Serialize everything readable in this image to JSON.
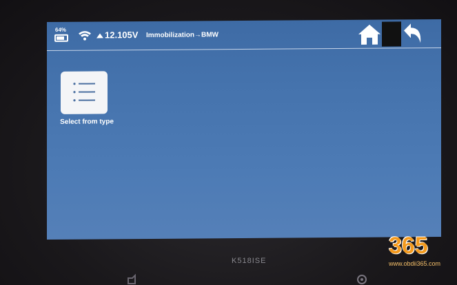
{
  "status_bar": {
    "battery_percent": "64%",
    "voltage": "12.105V",
    "breadcrumb": "Immobilization→BMW"
  },
  "main": {
    "tiles": [
      {
        "label": "Select from type",
        "icon": "list-icon"
      }
    ]
  },
  "device": {
    "model_label": "K518ISE"
  },
  "watermark": {
    "number": "365",
    "url": "www.obdii365.com"
  },
  "colors": {
    "screen_blue": "#4573ad",
    "tile_bg": "#f4f5f7",
    "watermark_orange": "#f39a1e"
  }
}
